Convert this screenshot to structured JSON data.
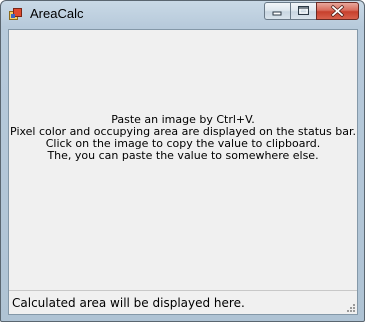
{
  "window": {
    "title": "AreaCalc",
    "icon": "app-icon",
    "controls": [
      "minimize-icon",
      "maximize-icon",
      "close-icon"
    ]
  },
  "main": {
    "instructions": [
      "Paste an image by Ctrl+V.",
      "Pixel color and occupying area are displayed on the status bar.",
      "Click on the image to copy the value to clipboard.",
      "The, you can paste the value to somewhere else."
    ]
  },
  "statusbar": {
    "text": "Calculated area will be displayed here."
  },
  "colors": {
    "titlebar": "#c9d9e6",
    "client_bg": "#f0f0f0",
    "close_button": "#c7402d"
  }
}
